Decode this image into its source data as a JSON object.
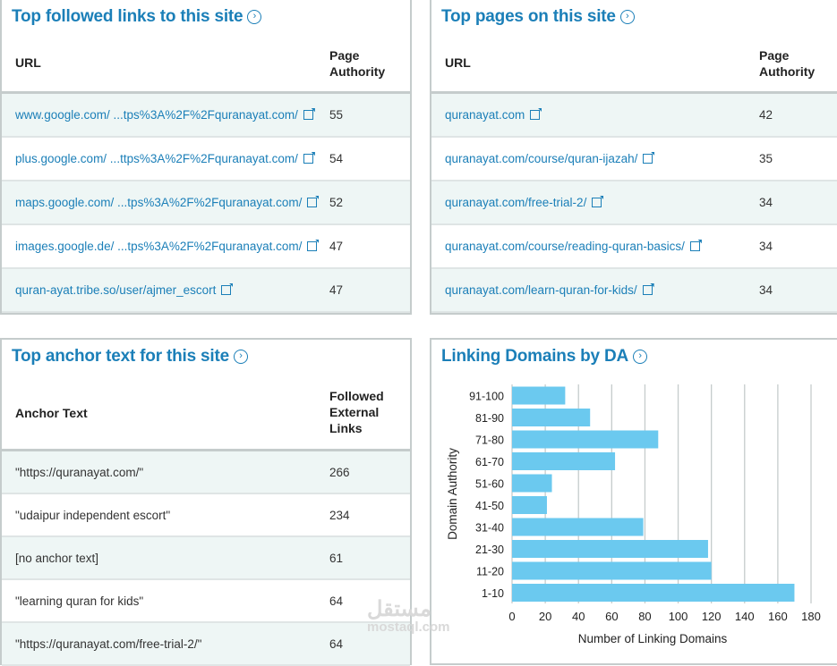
{
  "followed_links": {
    "title": "Top followed links to this site",
    "col1": "URL",
    "col2a": "Page",
    "col2b": "Authority",
    "rows": [
      {
        "url": "www.google.com/ ...tps%3A%2F%2Fquranayat.com/",
        "pa": "55"
      },
      {
        "url": "plus.google.com/ ...ttps%3A%2F%2Fquranayat.com/",
        "pa": "54"
      },
      {
        "url": "maps.google.com/ ...tps%3A%2F%2Fquranayat.com/",
        "pa": "52"
      },
      {
        "url": "images.google.de/ ...tps%3A%2F%2Fquranayat.com/",
        "pa": "47"
      },
      {
        "url": "quran-ayat.tribe.so/user/ajmer_escort",
        "pa": "47"
      }
    ]
  },
  "top_pages": {
    "title": "Top pages on this site",
    "col1": "URL",
    "col2a": "Page",
    "col2b": "Authority",
    "rows": [
      {
        "url": "quranayat.com",
        "pa": "42"
      },
      {
        "url": "quranayat.com/course/quran-ijazah/",
        "pa": "35"
      },
      {
        "url": "quranayat.com/free-trial-2/",
        "pa": "34"
      },
      {
        "url": "quranayat.com/course/reading-quran-basics/",
        "pa": "34"
      },
      {
        "url": "quranayat.com/learn-quran-for-kids/",
        "pa": "34"
      }
    ]
  },
  "anchor_text": {
    "title": "Top anchor text for this site",
    "col1": "Anchor Text",
    "col2a": "Followed",
    "col2b": "External",
    "col2c": "Links",
    "rows": [
      {
        "text": "\"https://quranayat.com/\"",
        "links": "266"
      },
      {
        "text": "\"udaipur independent escort\"",
        "links": "234"
      },
      {
        "text": "[no anchor text]",
        "links": "61"
      },
      {
        "text": "\"learning quran for kids\"",
        "links": "64"
      },
      {
        "text": "\"https://quranayat.com/free-trial-2/\"",
        "links": "64"
      }
    ]
  },
  "watermark": {
    "arabic": "مستقل",
    "latin": "mostaql.com"
  },
  "chart_data": {
    "title": "Linking Domains by DA",
    "type": "bar",
    "orientation": "horizontal",
    "categories": [
      "91-100",
      "81-90",
      "71-80",
      "61-70",
      "51-60",
      "41-50",
      "31-40",
      "21-30",
      "11-20",
      "1-10"
    ],
    "values": [
      32,
      47,
      88,
      62,
      24,
      21,
      79,
      118,
      120,
      170
    ],
    "xlabel": "Number of Linking Domains",
    "ylabel": "Domain Authority",
    "xlim": [
      0,
      180
    ],
    "xticks": [
      0,
      20,
      40,
      60,
      80,
      100,
      120,
      140,
      160,
      180
    ],
    "grid": true,
    "bar_color": "#6bc9ef"
  }
}
